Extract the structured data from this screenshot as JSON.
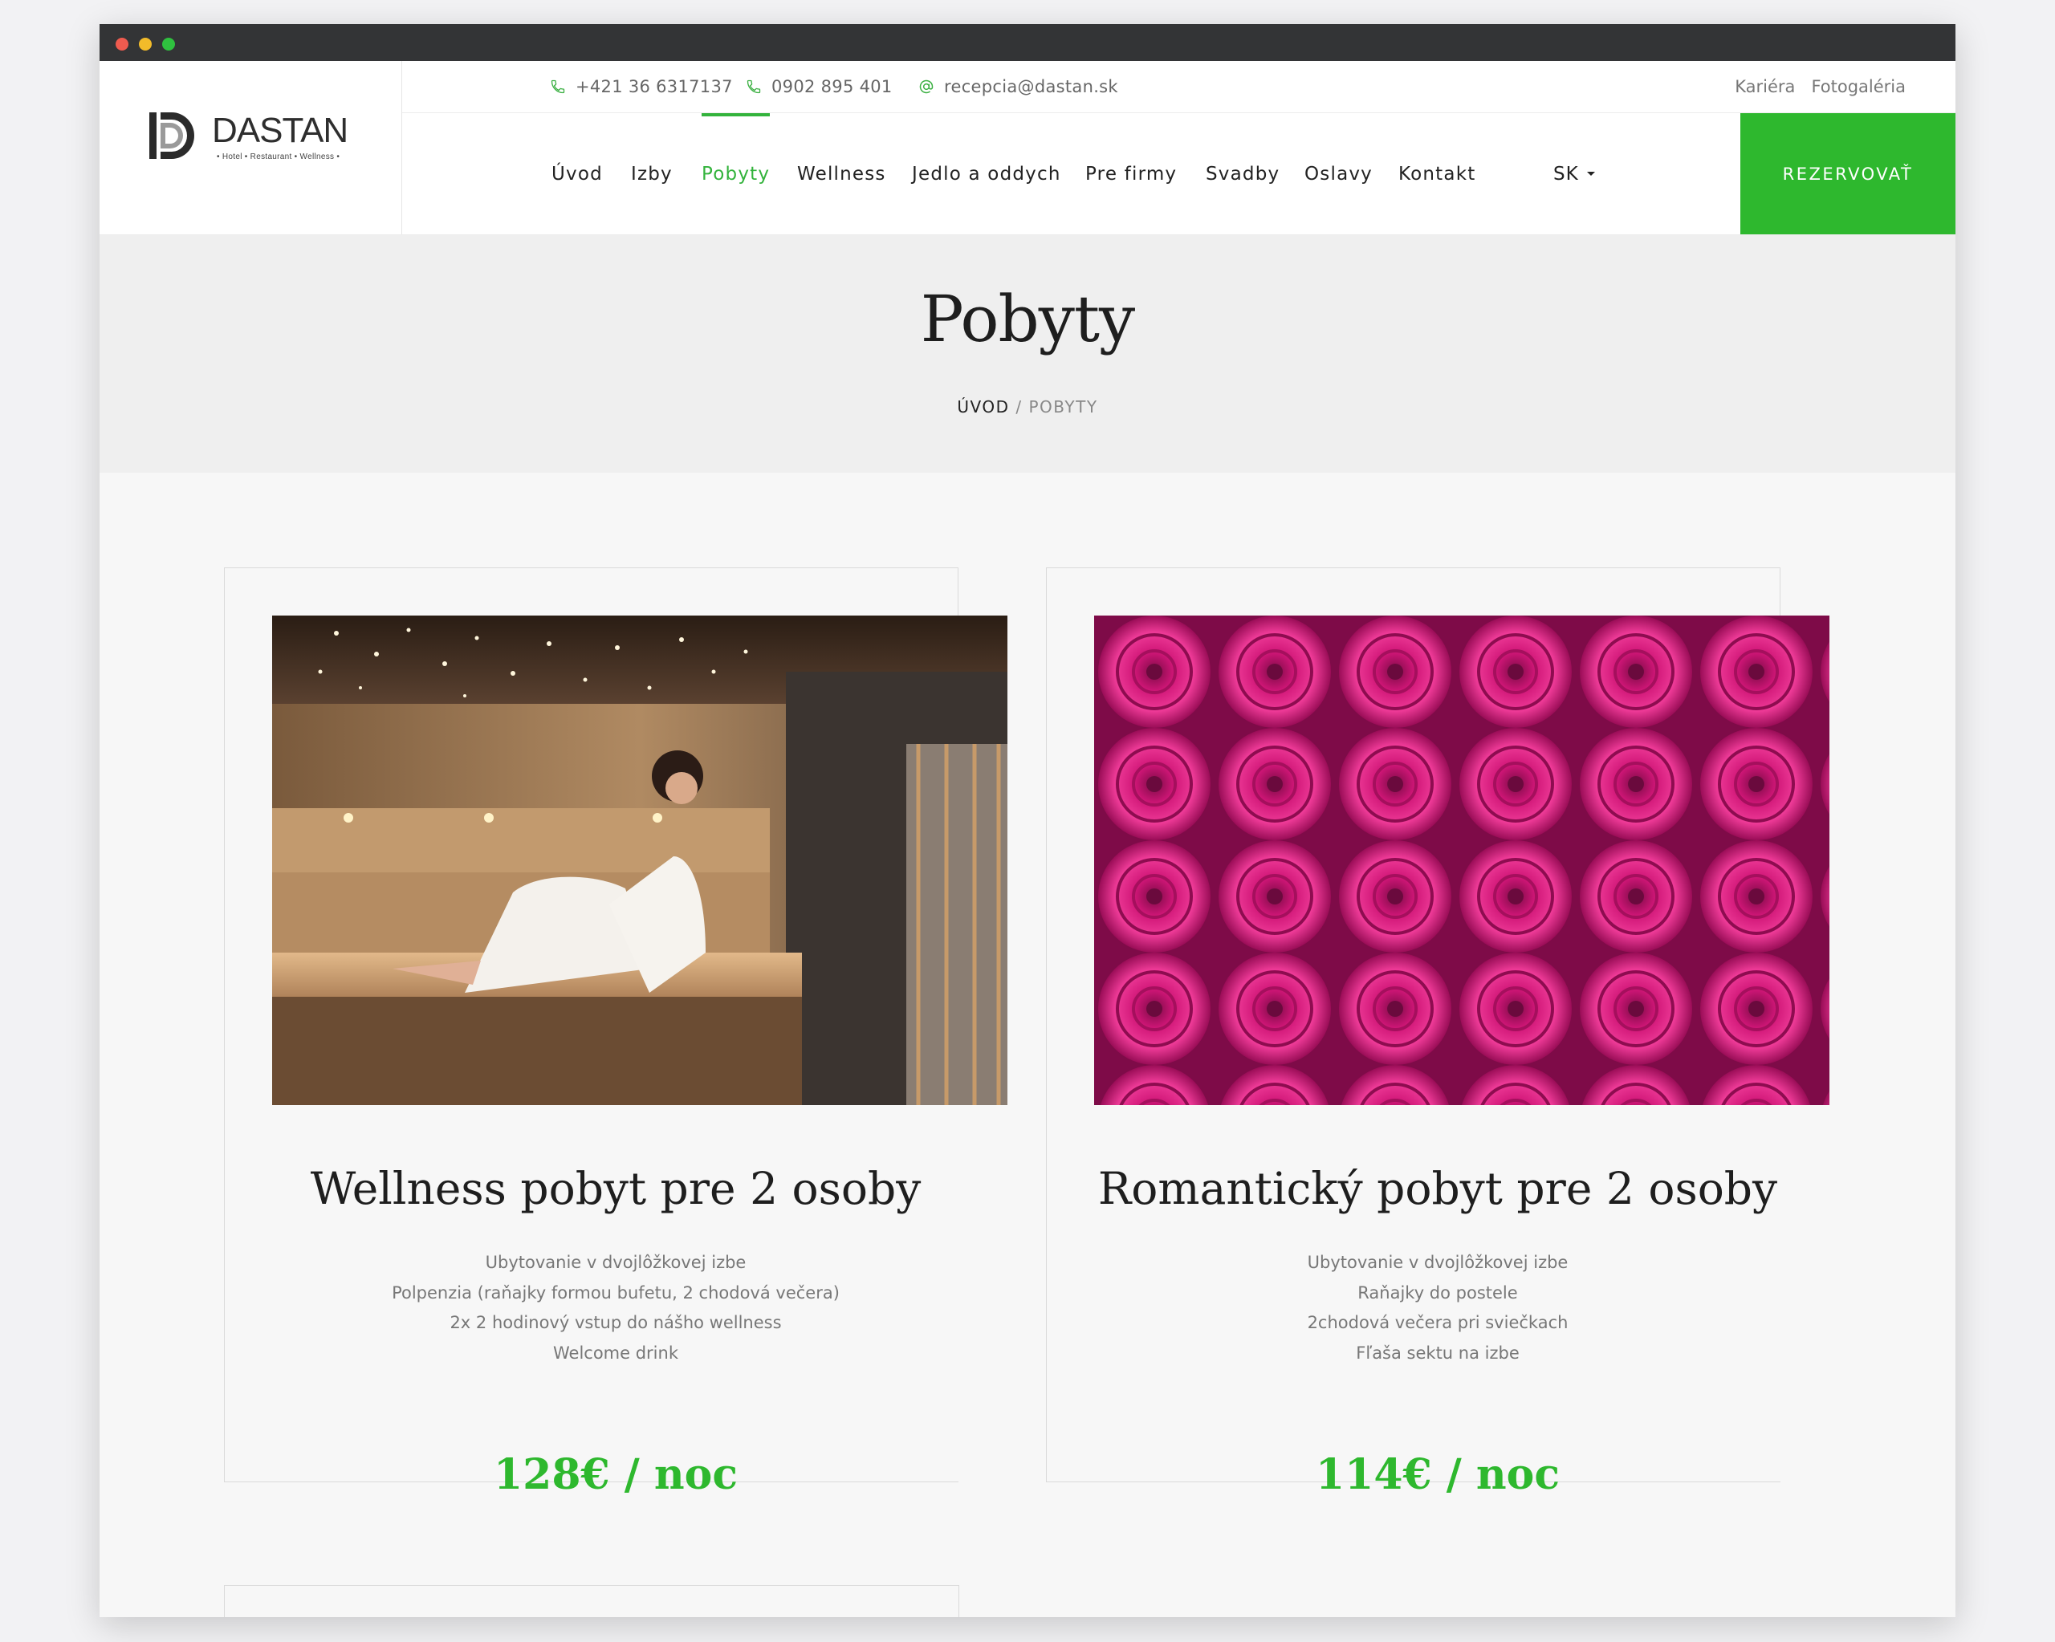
{
  "header": {
    "logo": {
      "name": "DASTAN",
      "tagline": "• Hotel • Restaurant • Wellness •"
    },
    "contacts": [
      {
        "icon": "phone-icon",
        "text": "+421 36 6317137"
      },
      {
        "icon": "phone-icon",
        "text": "0902 895 401"
      },
      {
        "icon": "at-icon",
        "text": "recepcia@dastan.sk"
      }
    ],
    "top_links": [
      "Kariéra",
      "Fotogaléria"
    ],
    "nav": [
      "Úvod",
      "Izby",
      "Pobyty",
      "Wellness",
      "Jedlo a oddych",
      "Pre firmy",
      "Svadby",
      "Oslavy",
      "Kontakt"
    ],
    "active_nav": "Pobyty",
    "language": "SK",
    "reserve_label": "REZERVOVAŤ"
  },
  "hero": {
    "title": "Pobyty",
    "breadcrumb": {
      "home": "ÚVOD",
      "separator": " / ",
      "current": "POBYTY"
    }
  },
  "cards": [
    {
      "title": "Wellness pobyt pre 2 osoby",
      "features": [
        "Ubytovanie v dvojlôžkovej izbe",
        "Polpenzia (raňajky formou bufetu, 2 chodová večera)",
        "2x 2 hodinový vstup do nášho wellness",
        "Welcome drink"
      ],
      "price": "128€ / noc"
    },
    {
      "title": "Romantický pobyt pre 2 osoby",
      "features": [
        "Ubytovanie v dvojlôžkovej izbe",
        "Raňajky do postele",
        "2chodová večera pri sviečkach",
        "Fľaša sektu na izbe"
      ],
      "price": "114€ / noc"
    }
  ],
  "colors": {
    "accent": "#2eb82e",
    "hero_bg": "#efefef",
    "page_bg": "#f7f7f7"
  }
}
